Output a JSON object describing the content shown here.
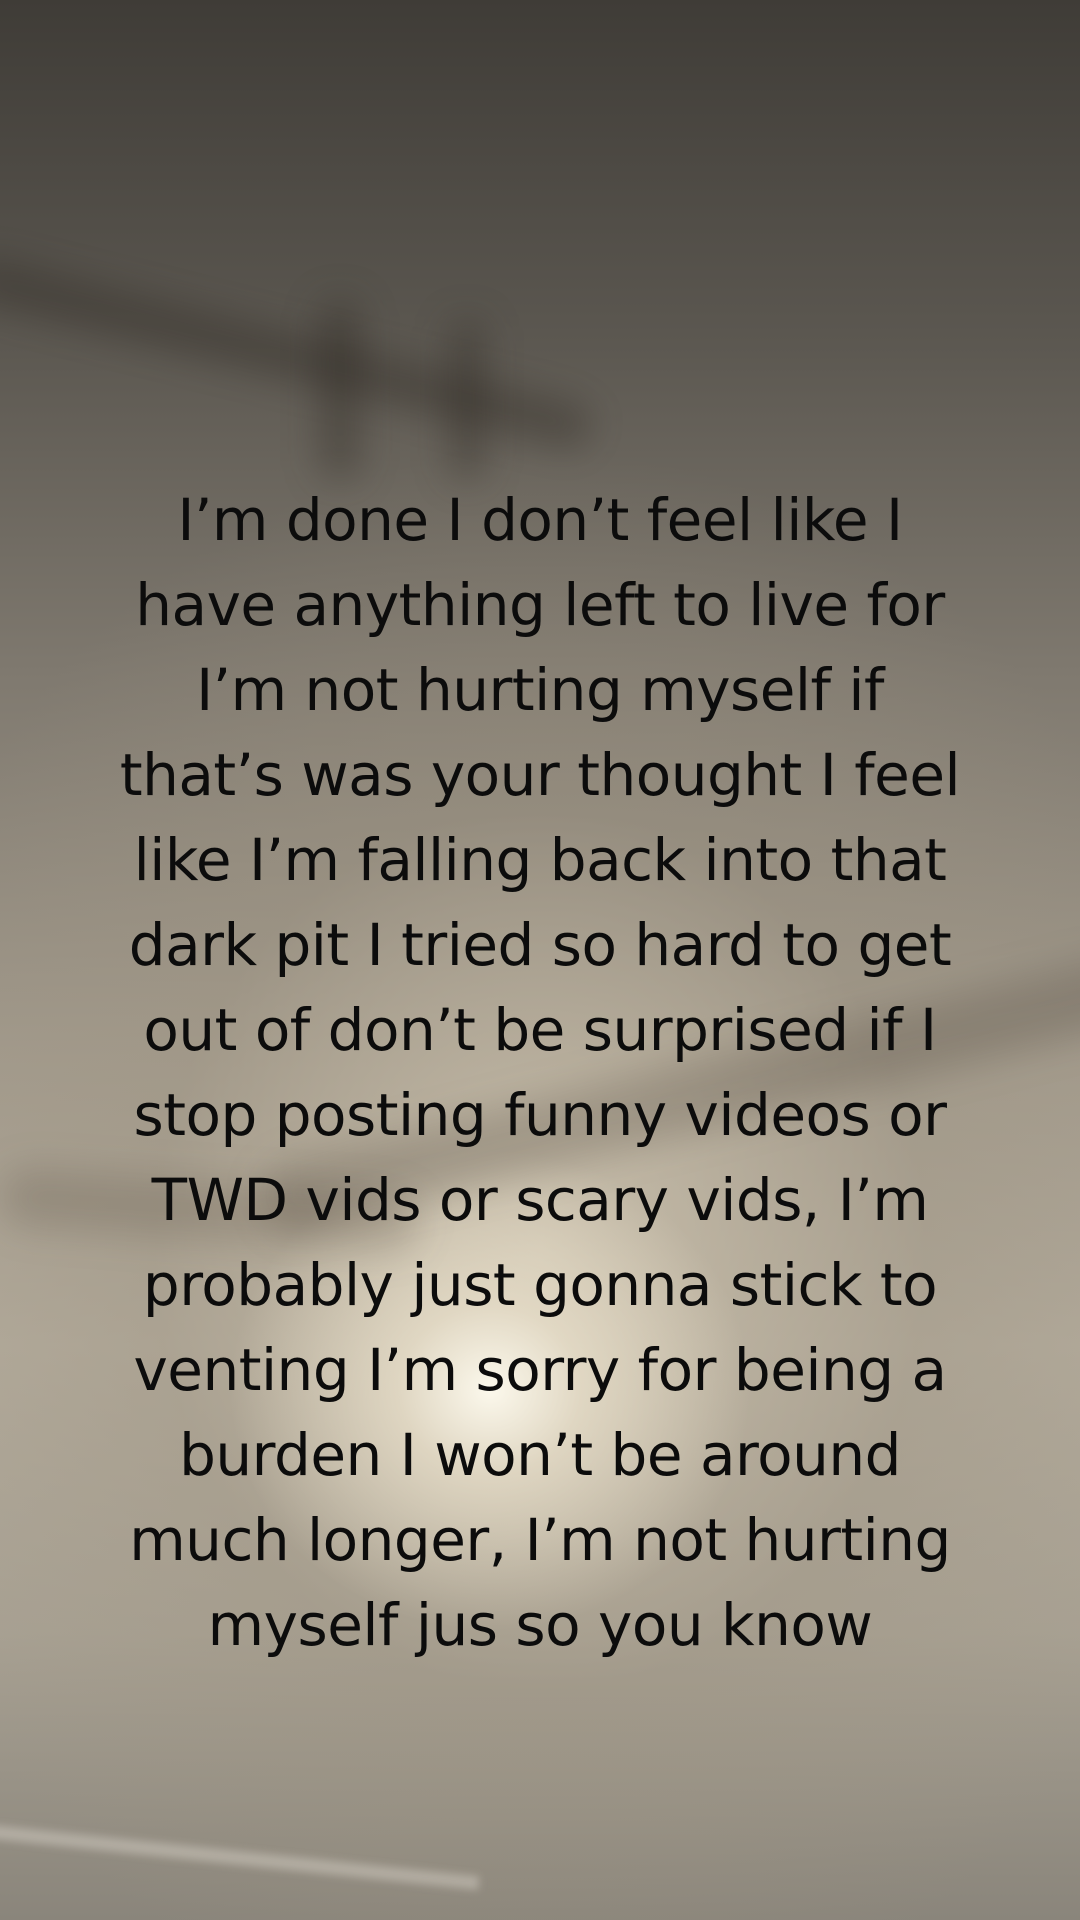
{
  "post": {
    "text_lines": [
      "I’m done I don’t feel like I",
      "have anything left to live for",
      "I’m not hurting myself if",
      "that’s was your thought I feel",
      "like I’m falling back into that",
      "dark pit I tried so hard to get",
      "out of don’t be surprised if I",
      "stop posting funny videos or",
      "TWD vids or scary vids, I’m",
      "probably just gonna stick to",
      "venting I’m sorry for being a",
      "burden I won’t be around",
      "much longer, I’m not hurting",
      "myself jus so you know"
    ],
    "text_color": "#0c0c0c"
  }
}
